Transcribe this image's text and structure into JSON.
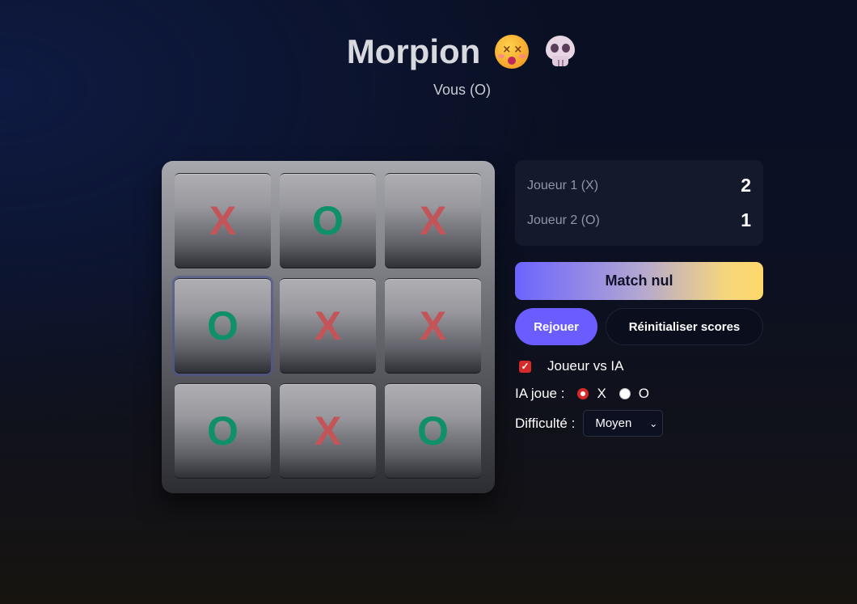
{
  "header": {
    "title": "Morpion",
    "icons": [
      "dizzy-face-icon",
      "skull-icon"
    ],
    "subtitle": "Vous (O)"
  },
  "board": {
    "cells": [
      "X",
      "O",
      "X",
      "O",
      "X",
      "X",
      "O",
      "X",
      "O"
    ]
  },
  "scores": [
    {
      "label": "Joueur 1 (X)",
      "value": "2"
    },
    {
      "label": "Joueur 2 (O)",
      "value": "1"
    }
  ],
  "status": "Match nul",
  "buttons": {
    "replay": "Rejouer",
    "reset": "Réinitialiser scores"
  },
  "options": {
    "vs_ai_label": "Joueur vs IA",
    "vs_ai_checked": true,
    "ai_plays_label": "IA joue :",
    "ai_plays_options": [
      "X",
      "O"
    ],
    "ai_plays_selected": "X",
    "difficulty_label": "Difficulté :",
    "difficulty_value": "Moyen"
  },
  "colors": {
    "x": "#c35458",
    "o": "#109069",
    "accent": "#6a5cff",
    "check": "#d42a2a"
  }
}
